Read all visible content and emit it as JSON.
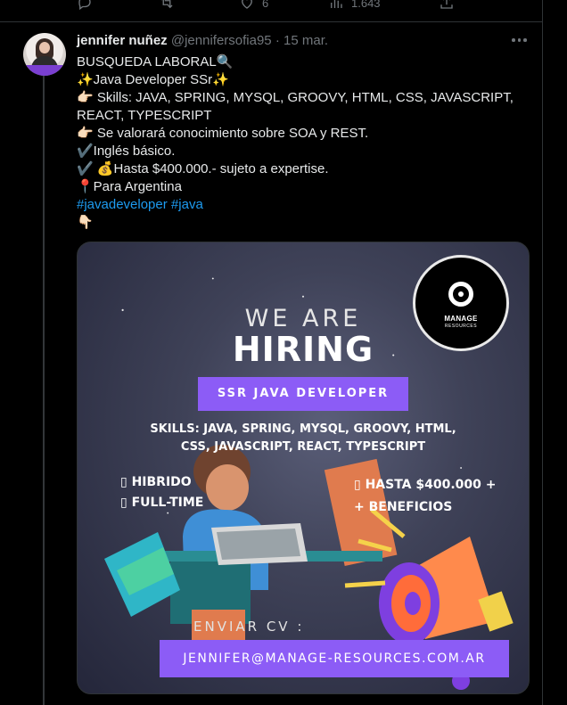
{
  "previous_tweet": {
    "actions": [
      {
        "name": "reply",
        "icon": "reply-icon",
        "count": ""
      },
      {
        "name": "retweet",
        "icon": "retweet-icon",
        "count": ""
      },
      {
        "name": "like",
        "icon": "heart-icon",
        "count": "6"
      },
      {
        "name": "views",
        "icon": "views-icon",
        "count": "1.643"
      },
      {
        "name": "share",
        "icon": "share-icon",
        "count": ""
      }
    ]
  },
  "tweet": {
    "author_name": "jennifer nuñez",
    "handle": "@jennifersofia95",
    "separator": "·",
    "date": "15 mar.",
    "lines": [
      "BUSQUEDA LABORAL🔍",
      "✨Java Developer SSr✨",
      "👉🏻 Skills: JAVA, SPRING, MYSQL, GROOVY, HTML, CSS, JAVASCRIPT,",
      "REACT, TYPESCRIPT",
      "👉🏻 Se valorará conocimiento sobre SOA y REST.",
      "✔️Inglés básico.",
      "✔️ 💰Hasta $400.000.- sujeto a expertise.",
      "📍Para Argentina"
    ],
    "hashtags": [
      "#javadeveloper",
      "#java"
    ],
    "trailing_emoji": "👇🏻"
  },
  "media": {
    "logo_title": "MANAGE",
    "logo_subtitle": "RESOURCES",
    "we_are": "WE ARE",
    "hiring": "HIRING",
    "role": "SSR JAVA DEVELOPER",
    "skills_line1": "SKILLS: JAVA, SPRING, MYSQL, GROOVY, HTML,",
    "skills_line2": "CSS, JAVASCRIPT, REACT, TYPESCRIPT",
    "left_items": [
      "▯ HIBRIDO",
      "▯ FULL-TIME"
    ],
    "right_items": [
      "▯ HASTA $400.000 +",
      "+ BENEFICIOS"
    ],
    "enviar_label": "ENVIAR CV :",
    "email": "JENNIFER@MANAGE-RESOURCES.COM.AR",
    "accent_color": "#8c5cf6"
  }
}
